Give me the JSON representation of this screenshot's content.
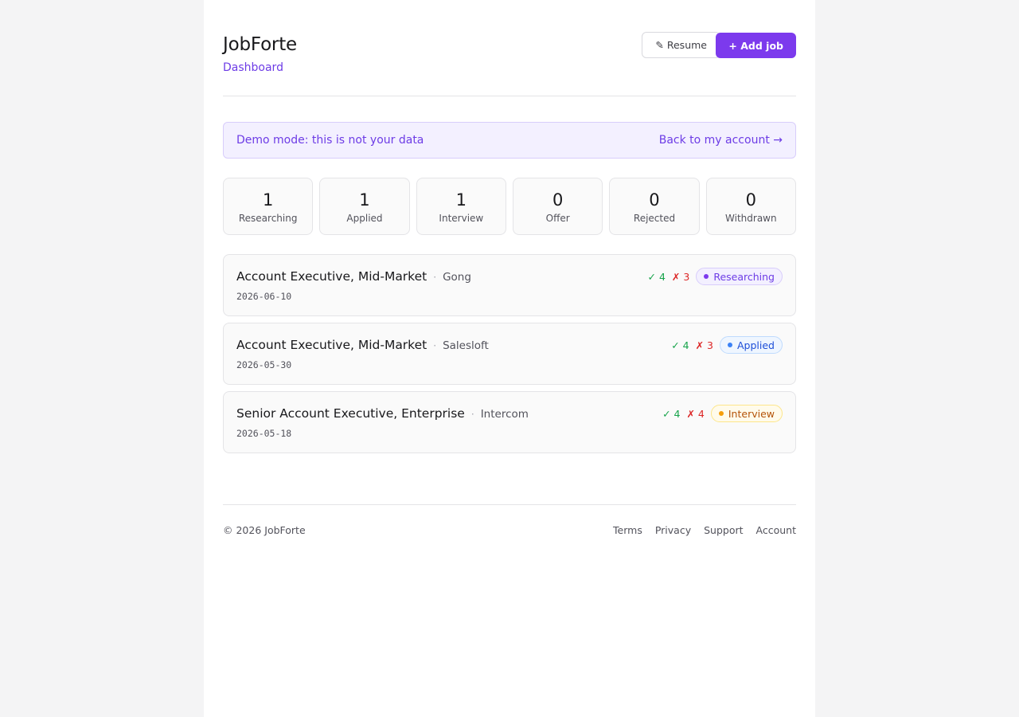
{
  "header": {
    "brand": "JobForte",
    "nav_link": "Dashboard",
    "resume_label": "✎ Resume",
    "add_job_label": "+ Add job"
  },
  "banner": {
    "message": "Demo mode: this is not your data",
    "link": "Back to my account →"
  },
  "stats": [
    {
      "count": "1",
      "label": "Researching"
    },
    {
      "count": "1",
      "label": "Applied"
    },
    {
      "count": "1",
      "label": "Interview"
    },
    {
      "count": "0",
      "label": "Offer"
    },
    {
      "count": "0",
      "label": "Rejected"
    },
    {
      "count": "0",
      "label": "Withdrawn"
    }
  ],
  "jobs": [
    {
      "title": "Account Executive, Mid-Market",
      "separator": "·",
      "company": "Gong",
      "date": "2026-06-10",
      "pros": "✓ 4",
      "cons": "✗ 3",
      "status": "Researching"
    },
    {
      "title": "Account Executive, Mid-Market",
      "separator": "·",
      "company": "Salesloft",
      "date": "2026-05-30",
      "pros": "✓ 4",
      "cons": "✗ 3",
      "status": "Applied"
    },
    {
      "title": "Senior Account Executive, Enterprise",
      "separator": "·",
      "company": "Intercom",
      "date": "2026-05-18",
      "pros": "✓ 4",
      "cons": "✗ 4",
      "status": "Interview"
    }
  ],
  "footer": {
    "copyright": "© 2026 JobForte",
    "links": [
      "Terms",
      "Privacy",
      "Support",
      "Account"
    ]
  },
  "colors": {
    "accent": "#7c3aed",
    "researching": "#7c3aed",
    "applied": "#3b82f6",
    "interview": "#f59e0b",
    "pros": "#16a34a",
    "cons": "#dc2626"
  }
}
